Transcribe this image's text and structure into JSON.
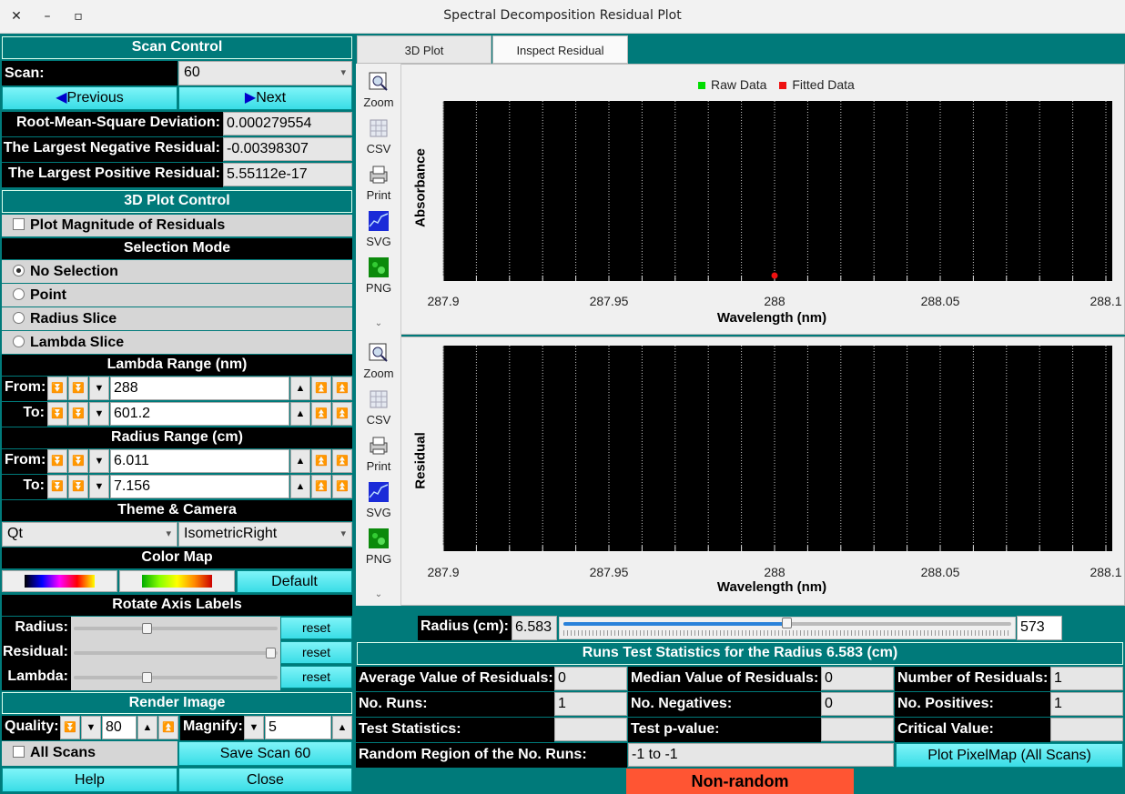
{
  "window": {
    "title": "Spectral Decomposition Residual Plot",
    "close": "✕",
    "minimize": "–",
    "maximize": "▫"
  },
  "scan_control": {
    "header": "Scan Control",
    "scan_label": "Scan:",
    "scan_value": "60",
    "previous": "Previous",
    "next": "Next",
    "rmsd_label": "Root-Mean-Square Deviation:",
    "rmsd_value": "0.000279554",
    "neg_label": "The Largest Negative Residual:",
    "neg_value": "-0.00398307",
    "pos_label": "The Largest Positive Residual:",
    "pos_value": "5.55112e-17"
  },
  "plot3d_control": {
    "header": "3D Plot Control",
    "magnitude_label": "Plot Magnitude of Residuals",
    "selection_header": "Selection Mode",
    "modes": [
      "No Selection",
      "Point",
      "Radius Slice",
      "Lambda Slice"
    ],
    "selected_mode": 0,
    "lambda_header": "Lambda Range (nm)",
    "from_label": "From:",
    "to_label": "To:",
    "lambda_from": "288",
    "lambda_to": "601.2",
    "radius_header": "Radius Range (cm)",
    "radius_from": "6.011",
    "radius_to": "7.156",
    "theme_header": "Theme & Camera",
    "theme": "Qt",
    "camera": "IsometricRight",
    "colormap_header": "Color Map",
    "default_label": "Default",
    "rotate_header": "Rotate Axis Labels",
    "rot_radius": "Radius:",
    "rot_residual": "Residual:",
    "rot_lambda": "Lambda:",
    "reset": "reset",
    "rot_levels": {
      "radius": 0.35,
      "residual": 0.99,
      "lambda": 0.35
    },
    "render_header": "Render Image",
    "quality_label": "Quality:",
    "quality": "80",
    "magnify_label": "Magnify:",
    "magnify": "5",
    "all_scans": "All Scans",
    "save_scan": "Save Scan 60",
    "help": "Help",
    "close": "Close"
  },
  "tabs": [
    "3D Plot",
    "Inspect Residual"
  ],
  "toolbar": [
    "Zoom",
    "CSV",
    "Print",
    "SVG",
    "PNG"
  ],
  "plot_top": {
    "legend": [
      "Raw Data",
      "Fitted Data"
    ],
    "ylabel": "Absorbance",
    "xlabel": "Wavelength (nm)",
    "xticks": [
      "287.9",
      "287.95",
      "288",
      "288.05",
      "288.1"
    ]
  },
  "plot_bottom": {
    "ylabel": "Residual",
    "xlabel": "Wavelength (nm)",
    "xticks": [
      "287.9",
      "287.95",
      "288",
      "288.05",
      "288.1"
    ]
  },
  "chart_data": [
    {
      "type": "scatter",
      "ylabel": "Absorbance",
      "xlabel": "Wavelength (nm)",
      "xlim": [
        287.9,
        288.1
      ],
      "series": [
        {
          "name": "Raw Data",
          "color": "#00dd00",
          "x": [],
          "y": []
        },
        {
          "name": "Fitted Data",
          "color": "#ee1111",
          "x": [
            288.0
          ],
          "y": [
            0
          ]
        }
      ],
      "grid": true,
      "legend": "top-center"
    },
    {
      "type": "scatter",
      "ylabel": "Residual",
      "xlabel": "Wavelength (nm)",
      "xlim": [
        287.9,
        288.1
      ],
      "series": [],
      "grid": true
    }
  ],
  "radius": {
    "label": "Radius (cm):",
    "value": "6.583",
    "index": "573",
    "level": 0.5
  },
  "stats": {
    "header": "Runs Test Statistics for the Radius 6.583 (cm)",
    "avg_label": "Average Value of Residuals:",
    "avg": "0",
    "median_label": "Median Value of Residuals:",
    "median": "0",
    "num_label": "Number of Residuals:",
    "num": "1",
    "runs_label": "No. Runs:",
    "runs": "1",
    "neg_label": "No. Negatives:",
    "neg": "0",
    "pos_label": "No. Positives:",
    "pos": "1",
    "test_label": "Test Statistics:",
    "test": "",
    "p_label": "Test p-value:",
    "p": "",
    "crit_label": "Critical Value:",
    "crit": "",
    "region_label": "Random Region of the No. Runs:",
    "region": "-1 to -1",
    "pixelmap": "Plot PixelMap (All Scans)",
    "result": "Non-random"
  },
  "colors": {
    "teal": "#007a7a",
    "cyan": "#39dde6",
    "nonrandom": "#ff5533"
  }
}
